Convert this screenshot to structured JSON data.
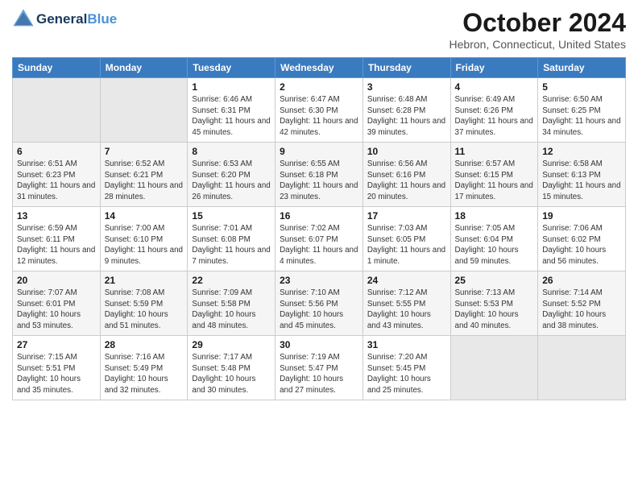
{
  "header": {
    "logo_line1": "General",
    "logo_line2": "Blue",
    "month": "October 2024",
    "location": "Hebron, Connecticut, United States"
  },
  "weekdays": [
    "Sunday",
    "Monday",
    "Tuesday",
    "Wednesday",
    "Thursday",
    "Friday",
    "Saturday"
  ],
  "weeks": [
    [
      {
        "day": "",
        "info": ""
      },
      {
        "day": "",
        "info": ""
      },
      {
        "day": "1",
        "info": "Sunrise: 6:46 AM\nSunset: 6:31 PM\nDaylight: 11 hours and 45 minutes."
      },
      {
        "day": "2",
        "info": "Sunrise: 6:47 AM\nSunset: 6:30 PM\nDaylight: 11 hours and 42 minutes."
      },
      {
        "day": "3",
        "info": "Sunrise: 6:48 AM\nSunset: 6:28 PM\nDaylight: 11 hours and 39 minutes."
      },
      {
        "day": "4",
        "info": "Sunrise: 6:49 AM\nSunset: 6:26 PM\nDaylight: 11 hours and 37 minutes."
      },
      {
        "day": "5",
        "info": "Sunrise: 6:50 AM\nSunset: 6:25 PM\nDaylight: 11 hours and 34 minutes."
      }
    ],
    [
      {
        "day": "6",
        "info": "Sunrise: 6:51 AM\nSunset: 6:23 PM\nDaylight: 11 hours and 31 minutes."
      },
      {
        "day": "7",
        "info": "Sunrise: 6:52 AM\nSunset: 6:21 PM\nDaylight: 11 hours and 28 minutes."
      },
      {
        "day": "8",
        "info": "Sunrise: 6:53 AM\nSunset: 6:20 PM\nDaylight: 11 hours and 26 minutes."
      },
      {
        "day": "9",
        "info": "Sunrise: 6:55 AM\nSunset: 6:18 PM\nDaylight: 11 hours and 23 minutes."
      },
      {
        "day": "10",
        "info": "Sunrise: 6:56 AM\nSunset: 6:16 PM\nDaylight: 11 hours and 20 minutes."
      },
      {
        "day": "11",
        "info": "Sunrise: 6:57 AM\nSunset: 6:15 PM\nDaylight: 11 hours and 17 minutes."
      },
      {
        "day": "12",
        "info": "Sunrise: 6:58 AM\nSunset: 6:13 PM\nDaylight: 11 hours and 15 minutes."
      }
    ],
    [
      {
        "day": "13",
        "info": "Sunrise: 6:59 AM\nSunset: 6:11 PM\nDaylight: 11 hours and 12 minutes."
      },
      {
        "day": "14",
        "info": "Sunrise: 7:00 AM\nSunset: 6:10 PM\nDaylight: 11 hours and 9 minutes."
      },
      {
        "day": "15",
        "info": "Sunrise: 7:01 AM\nSunset: 6:08 PM\nDaylight: 11 hours and 7 minutes."
      },
      {
        "day": "16",
        "info": "Sunrise: 7:02 AM\nSunset: 6:07 PM\nDaylight: 11 hours and 4 minutes."
      },
      {
        "day": "17",
        "info": "Sunrise: 7:03 AM\nSunset: 6:05 PM\nDaylight: 11 hours and 1 minute."
      },
      {
        "day": "18",
        "info": "Sunrise: 7:05 AM\nSunset: 6:04 PM\nDaylight: 10 hours and 59 minutes."
      },
      {
        "day": "19",
        "info": "Sunrise: 7:06 AM\nSunset: 6:02 PM\nDaylight: 10 hours and 56 minutes."
      }
    ],
    [
      {
        "day": "20",
        "info": "Sunrise: 7:07 AM\nSunset: 6:01 PM\nDaylight: 10 hours and 53 minutes."
      },
      {
        "day": "21",
        "info": "Sunrise: 7:08 AM\nSunset: 5:59 PM\nDaylight: 10 hours and 51 minutes."
      },
      {
        "day": "22",
        "info": "Sunrise: 7:09 AM\nSunset: 5:58 PM\nDaylight: 10 hours and 48 minutes."
      },
      {
        "day": "23",
        "info": "Sunrise: 7:10 AM\nSunset: 5:56 PM\nDaylight: 10 hours and 45 minutes."
      },
      {
        "day": "24",
        "info": "Sunrise: 7:12 AM\nSunset: 5:55 PM\nDaylight: 10 hours and 43 minutes."
      },
      {
        "day": "25",
        "info": "Sunrise: 7:13 AM\nSunset: 5:53 PM\nDaylight: 10 hours and 40 minutes."
      },
      {
        "day": "26",
        "info": "Sunrise: 7:14 AM\nSunset: 5:52 PM\nDaylight: 10 hours and 38 minutes."
      }
    ],
    [
      {
        "day": "27",
        "info": "Sunrise: 7:15 AM\nSunset: 5:51 PM\nDaylight: 10 hours and 35 minutes."
      },
      {
        "day": "28",
        "info": "Sunrise: 7:16 AM\nSunset: 5:49 PM\nDaylight: 10 hours and 32 minutes."
      },
      {
        "day": "29",
        "info": "Sunrise: 7:17 AM\nSunset: 5:48 PM\nDaylight: 10 hours and 30 minutes."
      },
      {
        "day": "30",
        "info": "Sunrise: 7:19 AM\nSunset: 5:47 PM\nDaylight: 10 hours and 27 minutes."
      },
      {
        "day": "31",
        "info": "Sunrise: 7:20 AM\nSunset: 5:45 PM\nDaylight: 10 hours and 25 minutes."
      },
      {
        "day": "",
        "info": ""
      },
      {
        "day": "",
        "info": ""
      }
    ]
  ]
}
